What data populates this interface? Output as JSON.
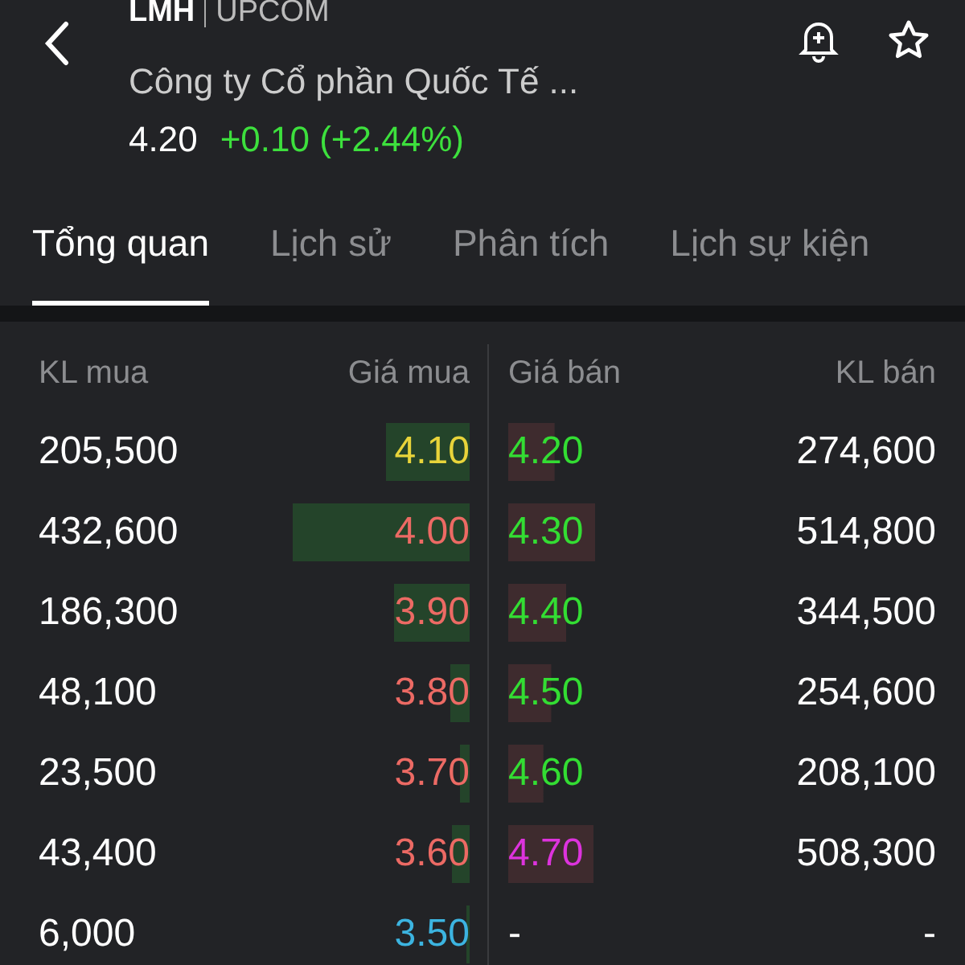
{
  "header": {
    "symbol": "LMH",
    "exchange": "UPCOM",
    "company": "Công ty Cổ phần Quốc Tế ...",
    "price": "4.20",
    "change": "+0.10 (+2.44%)"
  },
  "tabs": [
    {
      "label": "Tổng quan",
      "selected": true
    },
    {
      "label": "Lịch sử",
      "selected": false
    },
    {
      "label": "Phân tích",
      "selected": false
    },
    {
      "label": "Lịch sự kiện",
      "selected": false
    }
  ],
  "order_book": {
    "columns": [
      "KL mua",
      "Giá mua",
      "Giá bán",
      "KL bán"
    ],
    "rows": [
      {
        "bid": {
          "volume": "205,500",
          "price": "4.10",
          "color": "#e8d43a"
        },
        "ask": {
          "price": "4.20",
          "color": "#33dd33",
          "volume": "274,600"
        }
      },
      {
        "bid": {
          "volume": "432,600",
          "price": "4.00",
          "color": "#ec6a64"
        },
        "ask": {
          "price": "4.30",
          "color": "#33dd33",
          "volume": "514,800"
        }
      },
      {
        "bid": {
          "volume": "186,300",
          "price": "3.90",
          "color": "#ec6a64"
        },
        "ask": {
          "price": "4.40",
          "color": "#33dd33",
          "volume": "344,500"
        }
      },
      {
        "bid": {
          "volume": "48,100",
          "price": "3.80",
          "color": "#ec6a64"
        },
        "ask": {
          "price": "4.50",
          "color": "#33dd33",
          "volume": "254,600"
        }
      },
      {
        "bid": {
          "volume": "23,500",
          "price": "3.70",
          "color": "#ec6a64"
        },
        "ask": {
          "price": "4.60",
          "color": "#33dd33",
          "volume": "208,100"
        }
      },
      {
        "bid": {
          "volume": "43,400",
          "price": "3.60",
          "color": "#ec6a64"
        },
        "ask": {
          "price": "4.70",
          "color": "#dd33dd",
          "volume": "508,300"
        }
      },
      {
        "bid": {
          "volume": "6,000",
          "price": "3.50",
          "color": "#3cb4e0"
        },
        "ask": {
          "price": "-",
          "color": "#ffffff",
          "volume": "-"
        }
      }
    ]
  }
}
